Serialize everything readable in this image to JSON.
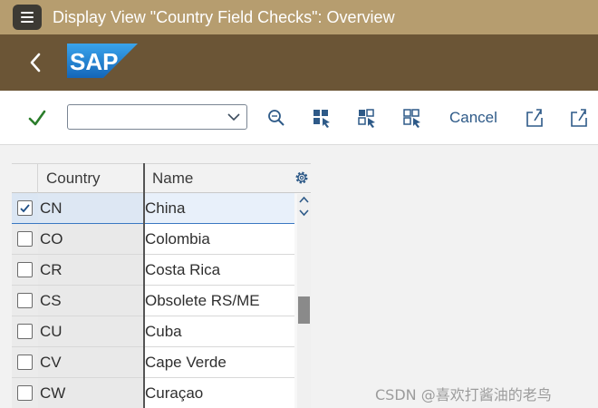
{
  "window": {
    "title": "Display View \"Country Field Checks\": Overview"
  },
  "shell": {
    "logo_text": "SAP"
  },
  "toolbar": {
    "combo_value": "",
    "cancel_label": "Cancel"
  },
  "table": {
    "columns": [
      "Country",
      "Name"
    ],
    "rows": [
      {
        "code": "CN",
        "name": "China",
        "checked": true
      },
      {
        "code": "CO",
        "name": "Colombia",
        "checked": false
      },
      {
        "code": "CR",
        "name": "Costa Rica",
        "checked": false
      },
      {
        "code": "CS",
        "name": "Obsolete RS/ME",
        "checked": false
      },
      {
        "code": "CU",
        "name": "Cuba",
        "checked": false
      },
      {
        "code": "CV",
        "name": "Cape Verde",
        "checked": false
      },
      {
        "code": "CW",
        "name": "Curaçao",
        "checked": false
      }
    ]
  },
  "watermark": "CSDN @喜欢打酱油的老鸟",
  "colors": {
    "title_bar": "#b69d6f",
    "shell_bar": "#6b5536",
    "sap_blue": "#1b7bd0",
    "accent_text": "#2e5a88",
    "check_green": "#2b7d2b"
  }
}
